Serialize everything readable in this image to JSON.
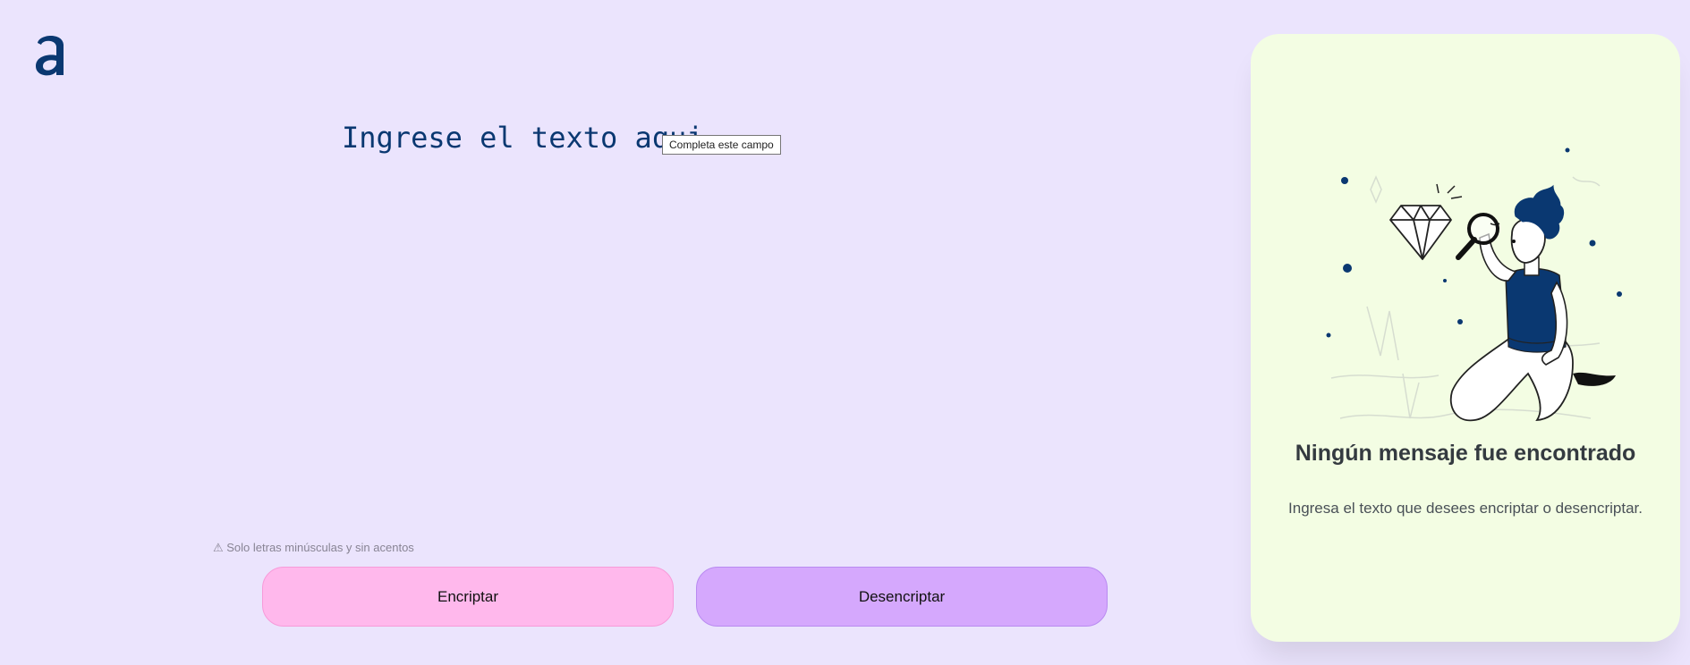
{
  "app": {
    "logo_name": "alura-logo",
    "accent_color": "#0a3871",
    "background_color": "#ebe4fd"
  },
  "input": {
    "value": "",
    "placeholder": "Ingrese el texto aqui",
    "validation_tooltip": "Completa este campo"
  },
  "hint": {
    "icon": "warning-icon",
    "text": "⚠ Solo letras minúsculas y sin acentos"
  },
  "buttons": {
    "encrypt_label": "Encriptar",
    "encrypt_color": "#ffb8ec",
    "decrypt_label": "Desencriptar",
    "decrypt_color": "#d5a8fd"
  },
  "output_panel": {
    "background_color": "#f3fde3",
    "illustration": "person-with-magnifier-and-diamond",
    "title": "Ningún mensaje fue encontrado",
    "description": "Ingresa el texto que desees encriptar o desencriptar."
  }
}
